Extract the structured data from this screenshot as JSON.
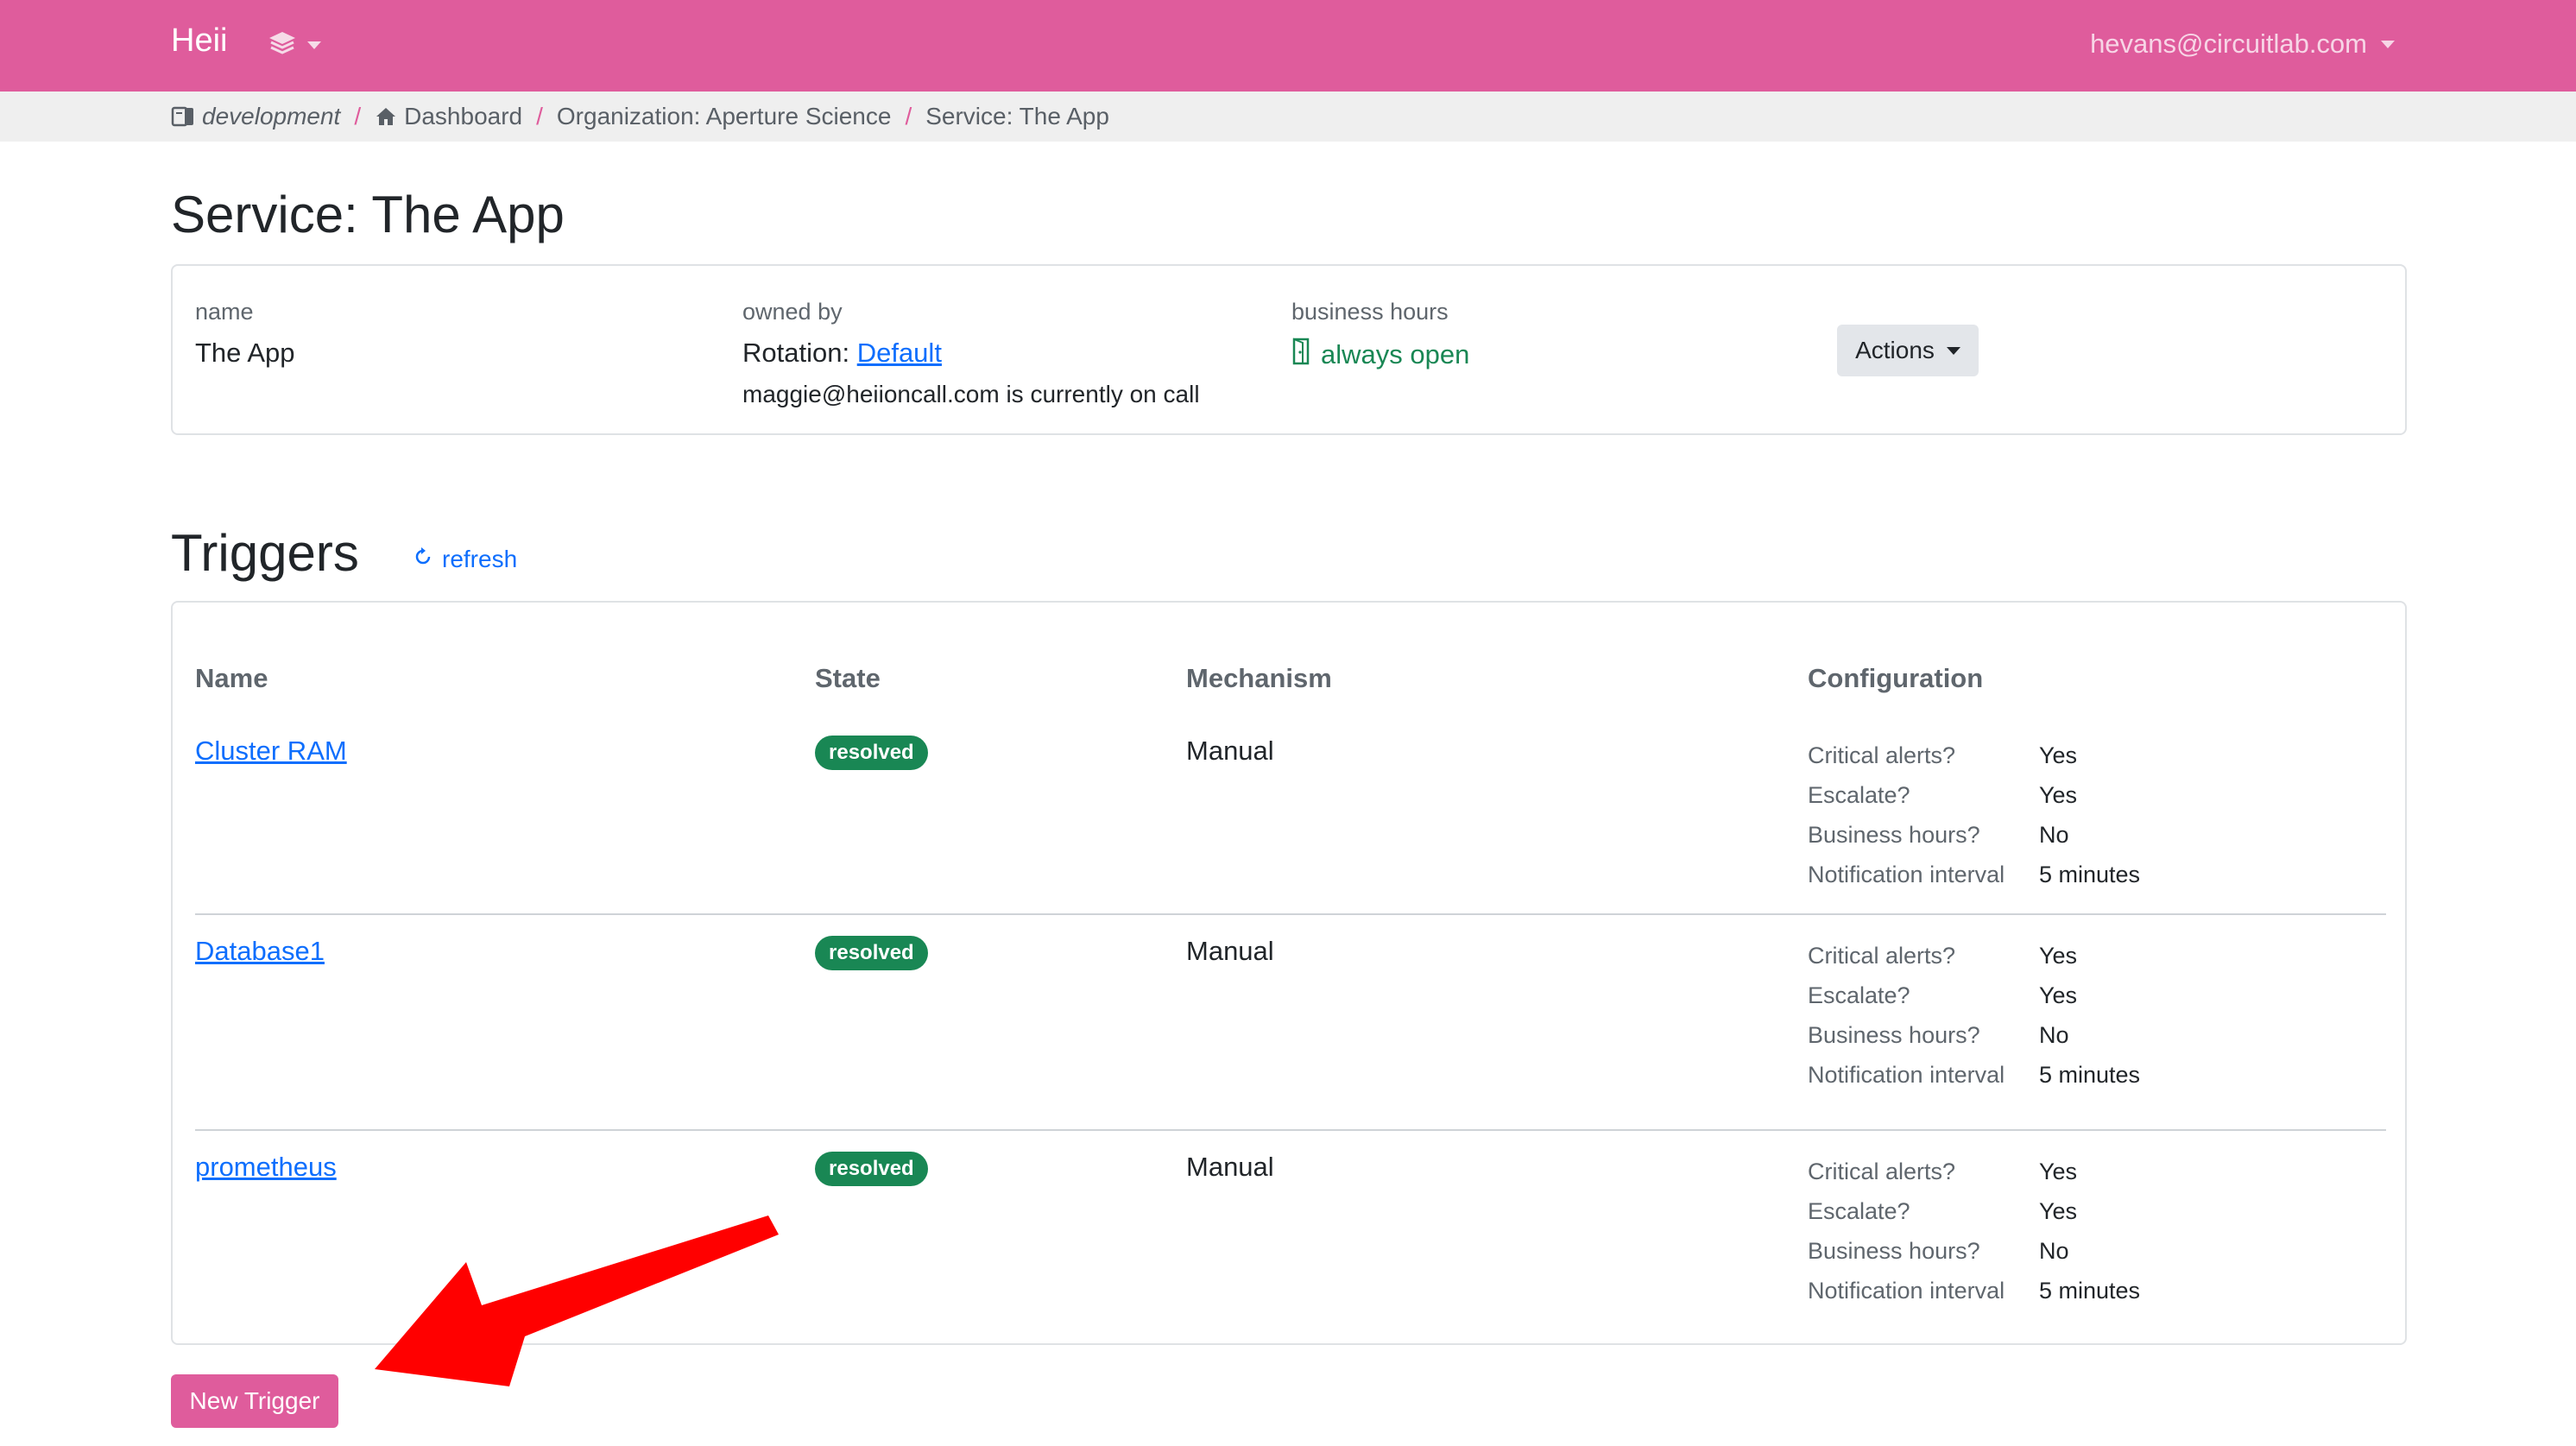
{
  "navbar": {
    "brand": "Heii",
    "layers_icon": "layers-icon",
    "user_email": "hevans@circuitlab.com",
    "color": "#df5c9c"
  },
  "breadcrumb": {
    "environment": "development",
    "dashboard": "Dashboard",
    "organization": "Organization: Aperture Science",
    "service": "Service: The App"
  },
  "page": {
    "title": "Service: The App"
  },
  "service_info": {
    "name_label": "name",
    "name_value": "The App",
    "owned_by_label": "owned by",
    "rotation_prefix": "Rotation: ",
    "rotation_link": "Default",
    "on_call_text": "maggie@heiioncall.com is currently on call",
    "business_hours_label": "business hours",
    "business_hours_value": "always open",
    "actions_label": "Actions"
  },
  "triggers": {
    "title": "Triggers",
    "refresh_label": "refresh",
    "columns": [
      "Name",
      "State",
      "Mechanism",
      "Configuration"
    ],
    "config_keys": [
      "Critical alerts?",
      "Escalate?",
      "Business hours?",
      "Notification interval"
    ],
    "rows": [
      {
        "name": "Cluster RAM",
        "state": "resolved",
        "mechanism": "Manual",
        "config": [
          "Yes",
          "Yes",
          "No",
          "5 minutes"
        ]
      },
      {
        "name": "Database1",
        "state": "resolved",
        "mechanism": "Manual",
        "config": [
          "Yes",
          "Yes",
          "No",
          "5 minutes"
        ]
      },
      {
        "name": "prometheus",
        "state": "resolved",
        "mechanism": "Manual",
        "config": [
          "Yes",
          "Yes",
          "No",
          "5 minutes"
        ]
      }
    ],
    "new_trigger_label": "New Trigger"
  },
  "annotation": {
    "arrow_color": "#ff0000"
  }
}
